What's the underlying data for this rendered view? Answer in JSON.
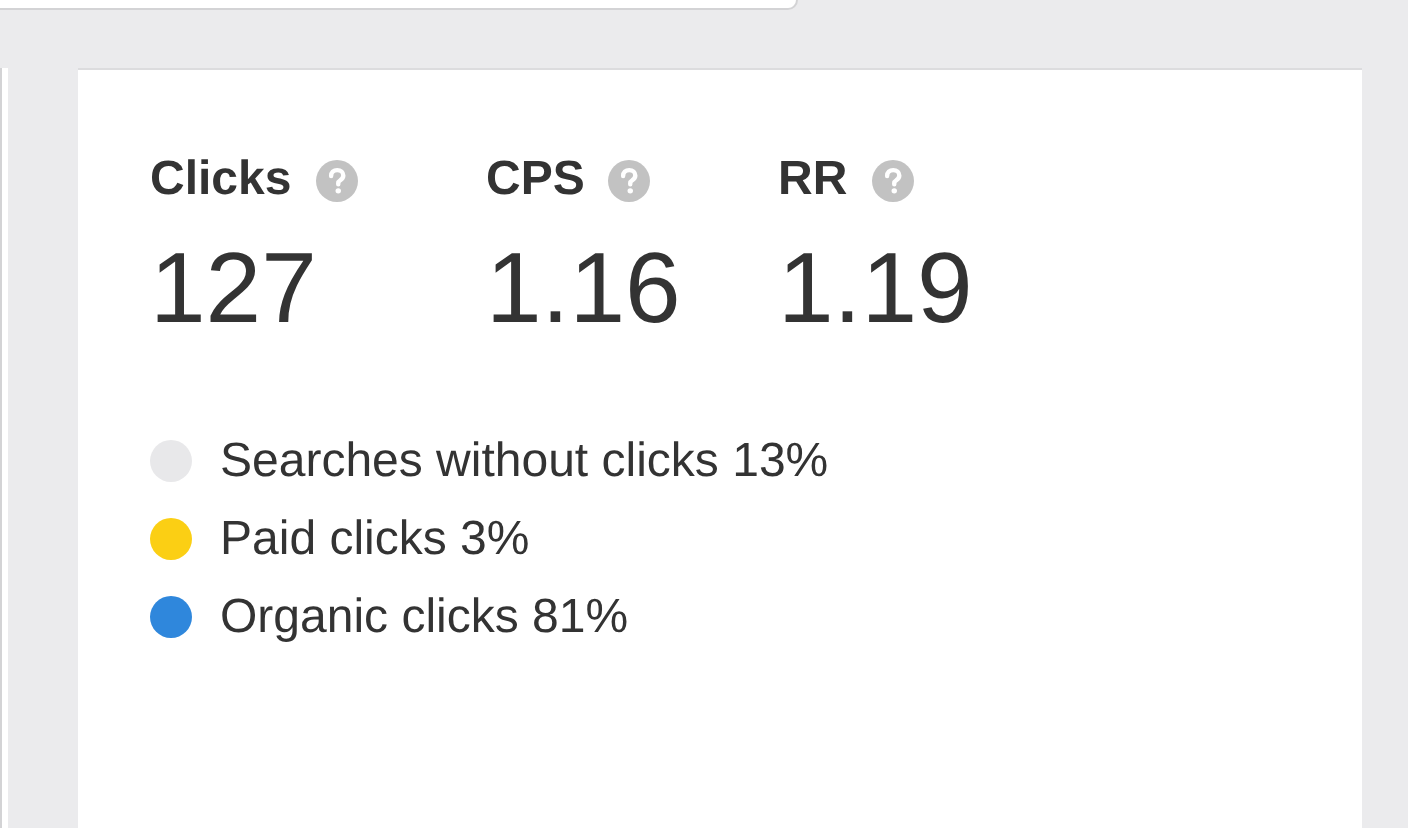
{
  "metrics": [
    {
      "label": "Clicks",
      "value": "127"
    },
    {
      "label": "CPS",
      "value": "1.16"
    },
    {
      "label": "RR",
      "value": "1.19"
    }
  ],
  "legend": [
    {
      "label": "Searches without clicks 13%",
      "color": "#e8e8ea"
    },
    {
      "label": "Paid clicks 3%",
      "color": "#fbcf14"
    },
    {
      "label": "Organic clicks 81%",
      "color": "#2f87dc"
    }
  ]
}
